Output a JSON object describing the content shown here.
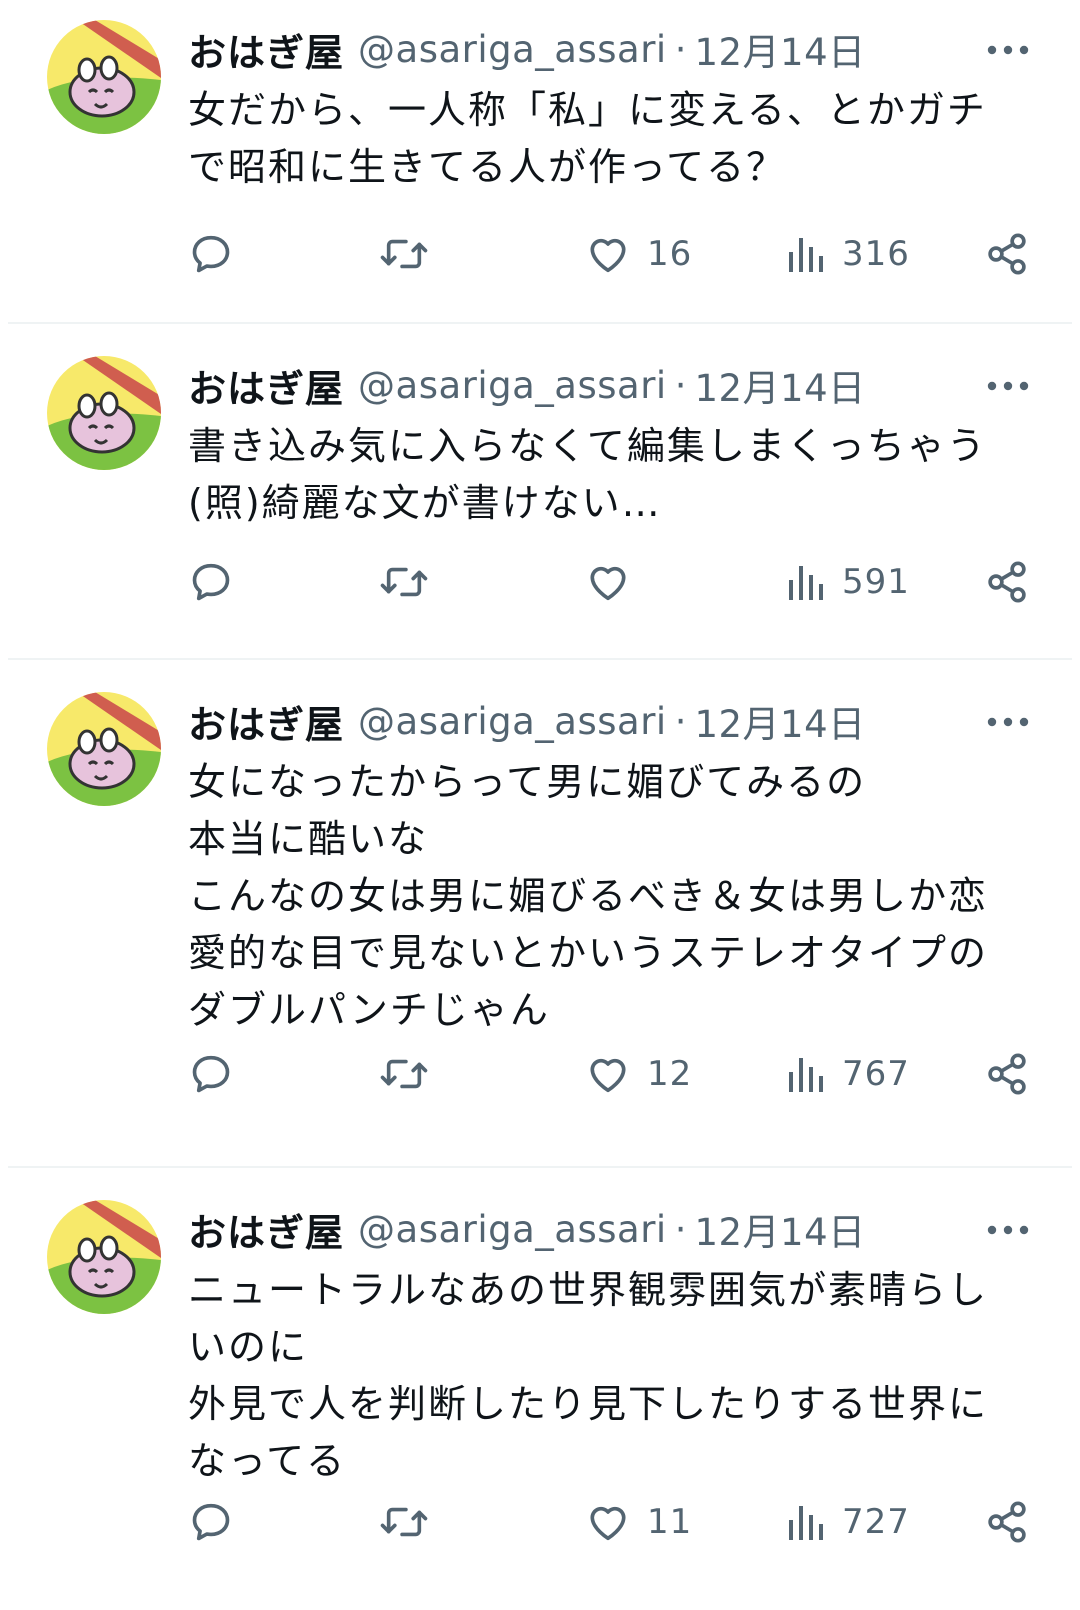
{
  "posts": [
    {
      "name": "おはぎ屋",
      "handle": "@asariga_assari",
      "separator": "·",
      "date": "12月14日",
      "body": "女だから、一人称「私」に変える、とかガチ\nで昭和に生きてる人が作ってる？",
      "likes": "16",
      "views": "316"
    },
    {
      "name": "おはぎ屋",
      "handle": "@asariga_assari",
      "separator": "·",
      "date": "12月14日",
      "body": "書き込み気に入らなくて編集しまくっちゃう\n(照)綺麗な文が書けない…",
      "likes": "",
      "views": "591"
    },
    {
      "name": "おはぎ屋",
      "handle": "@asariga_assari",
      "separator": "·",
      "date": "12月14日",
      "body": "女になったからって男に媚びてみるの\n本当に酷いな\nこんなの女は男に媚びるべき＆女は男しか恋\n愛的な目で見ないとかいうステレオタイプの\nダブルパンチじゃん",
      "likes": "12",
      "views": "767"
    },
    {
      "name": "おはぎ屋",
      "handle": "@asariga_assari",
      "separator": "·",
      "date": "12月14日",
      "body": "ニュートラルなあの世界観雰囲気が素晴らし\nいのに\n外見で人を判断したり見下したりする世界に\nなってる",
      "likes": "11",
      "views": "727"
    }
  ],
  "icons": {
    "reply": "speech-bubble-icon",
    "repost": "repost-arrows-icon",
    "like": "heart-icon",
    "views": "bar-chart-icon",
    "share": "share-nodes-icon",
    "more": "ellipsis-icon"
  },
  "colors": {
    "text": "#0f1419",
    "muted": "#536471",
    "divider": "#eff3f4"
  }
}
